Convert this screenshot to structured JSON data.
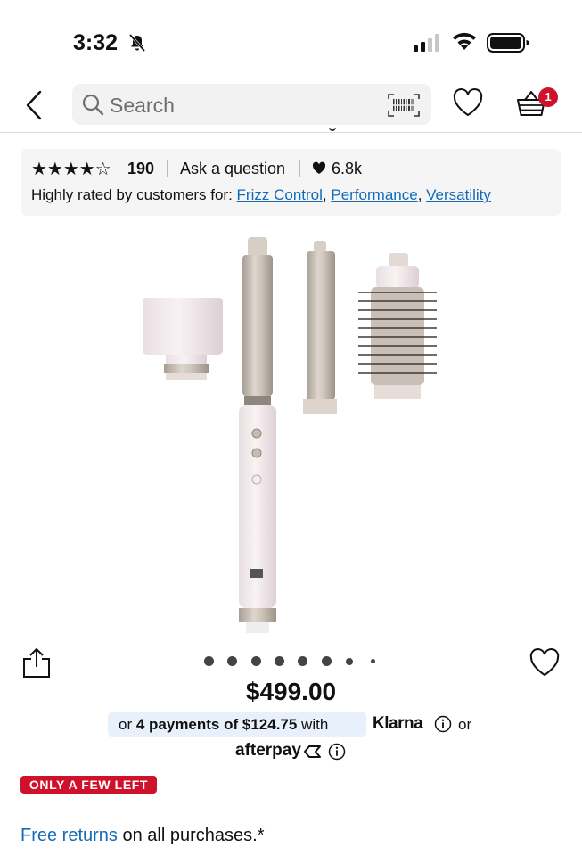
{
  "status": {
    "time": "3:32",
    "icons": [
      "bell-slash-icon",
      "signal-icon",
      "wifi-icon",
      "battery-icon"
    ]
  },
  "nav": {
    "search_placeholder": "Search",
    "icons": [
      "back-icon",
      "search-icon",
      "barcode-icon",
      "heart-icon",
      "basket-icon"
    ],
    "basket_count": "1"
  },
  "ratings": {
    "stars": "★★★★☆",
    "rating_value": 4.5,
    "review_count": "190",
    "ask_label": "Ask a question",
    "loves_count": "6.8k",
    "highly_rated_prefix": "Highly rated by customers for:",
    "highlights": [
      "Frizz Control",
      "Performance",
      "Versatility"
    ]
  },
  "gallery": {
    "dot_count": 8,
    "active_dot": 0
  },
  "price": {
    "amount": "$499.00",
    "installment_prefix": "or ",
    "installment_bold": "4 payments of $124.75",
    "installment_suffix": " with",
    "klarna": "Klarna",
    "or": "or",
    "afterpay": "afterpay"
  },
  "stock_badge": "ONLY A FEW LEFT",
  "returns": {
    "link": "Free returns",
    "rest": " on all purchases.*"
  },
  "colors": {
    "accent_red": "#cf112c",
    "link_blue": "#136bb7",
    "panel_gray": "#f5f5f5",
    "klarna_pill": "#e8f1fb"
  }
}
